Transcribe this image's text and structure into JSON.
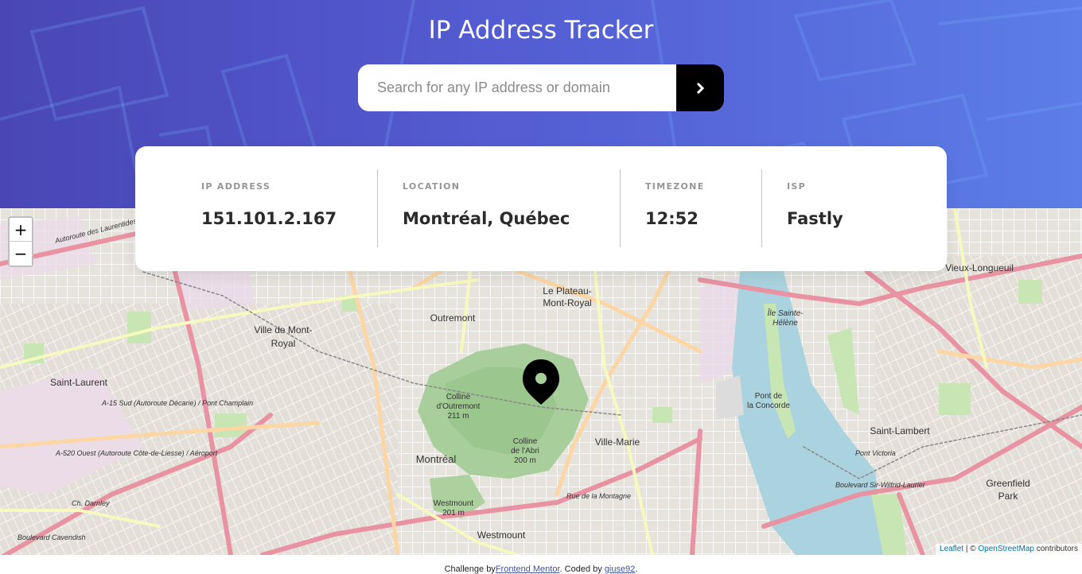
{
  "header": {
    "title": "IP Address Tracker",
    "search_placeholder": "Search for any IP address or domain",
    "search_value": "",
    "submit_icon": "chevron-right-icon"
  },
  "info": {
    "ip_label": "IP ADDRESS",
    "ip_value": "151.101.2.167",
    "location_label": "LOCATION",
    "location_value": "Montréal, Québec",
    "timezone_label": "TIMEZONE",
    "timezone_value": "12:52",
    "isp_label": "ISP",
    "isp_value": "Fastly"
  },
  "map": {
    "zoom_in": "+",
    "zoom_out": "−",
    "marker_icon": "location-pin-icon",
    "attribution": {
      "leaflet": "Leaflet",
      "separator": " | © ",
      "osm": "OpenStreetMap",
      "suffix": " contributors"
    },
    "labels": {
      "plateau_1": "Le Plateau-",
      "plateau_2": "Mont-Royal",
      "outremont": "Outremont",
      "mont_royal_1": "Ville de Mont-",
      "mont_royal_2": "Royal",
      "saint_laurent": "Saint-Laurent",
      "montreal": "Montréal",
      "ville_marie": "Ville-Marie",
      "westmount": "Westmount",
      "vieux_longueuil": "Vieux-Longueuil",
      "saint_lambert": "Saint-Lambert",
      "greenfield_1": "Greenfield",
      "greenfield_2": "Park",
      "ile_1": "Île Sainte-",
      "ile_2": "Hélène",
      "pont_1": "Pont de",
      "pont_2": "la Concorde",
      "colline_outremont_1": "Colline",
      "colline_outremont_2": "d'Outremont",
      "colline_outremont_3": "211 m",
      "colline_abri_1": "Colline",
      "colline_abri_2": "de l'Abri",
      "colline_abri_3": "200 m",
      "westmount_peak_1": "Westmount",
      "westmount_peak_2": "201 m",
      "a15": "A-15 Sud (Autoroute Décarie) / Pont Champlain",
      "a520": "A-520 Ouest (Autoroute Côte-de-Liesse) / Aéroport",
      "autoroute_laurentides": "Autoroute des Laurentides",
      "rue_montagne": "Rue de la Montagne",
      "boulevard_wilfrid": "Boulevard Sir-Wilfrid-Laurier",
      "pont_victoria": "Pont Victoria",
      "ch_darnley": "Ch. Darnley",
      "boulevard_cavendish": "Boulevard Cavendish"
    }
  },
  "footer": {
    "prefix": "Challenge by",
    "challenge_link": "Frontend Mentor",
    "middle": ". Coded by ",
    "author_link": "giuse92",
    "suffix": "."
  },
  "colors": {
    "header_start": "#4a46b6",
    "header_end": "#5c7ee6",
    "text_dark": "#2b2b2b",
    "label_gray": "#969696"
  }
}
